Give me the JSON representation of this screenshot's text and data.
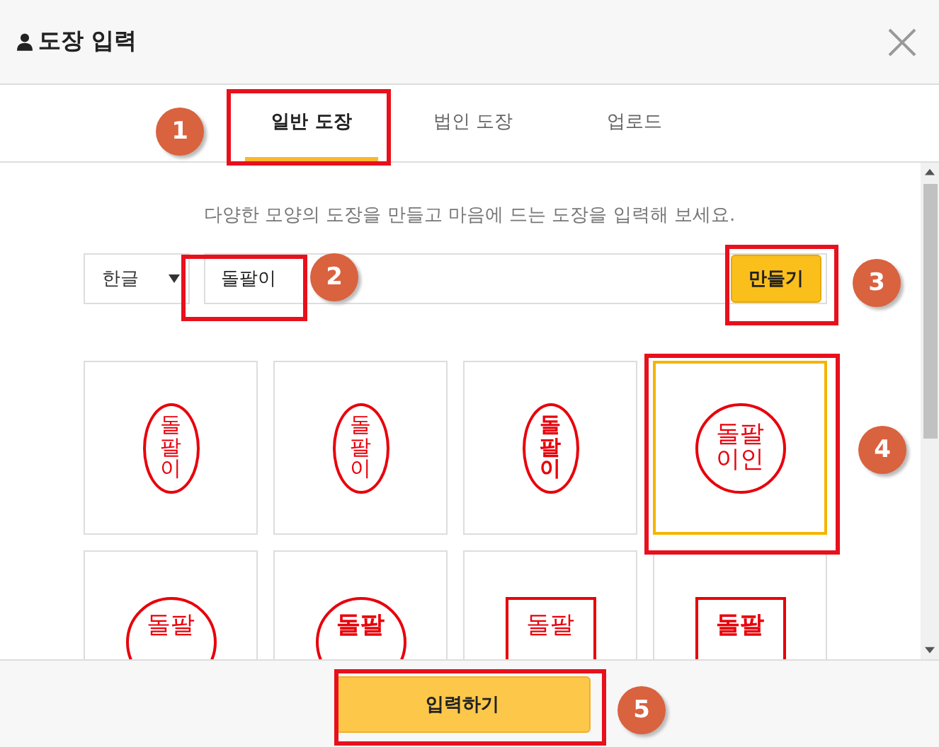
{
  "window": {
    "title": "도장 입력"
  },
  "tabs": [
    {
      "label": "일반 도장",
      "selected": true
    },
    {
      "label": "법인 도장",
      "selected": false
    },
    {
      "label": "업로드",
      "selected": false
    }
  ],
  "description": "다양한 모양의 도장을 만들고 마음에 드는 도장을 입력해 보세요.",
  "language_select": {
    "value": "한글"
  },
  "name_field": {
    "value": "돌팔이"
  },
  "make_button": "만들기",
  "stamps": [
    {
      "kind": "sealoval",
      "lines": [
        "돌",
        "팔",
        "이"
      ],
      "selected": false
    },
    {
      "kind": "oval",
      "lines": [
        "돌",
        "팔",
        "이"
      ],
      "selected": false
    },
    {
      "kind": "boldoval",
      "lines": [
        "돌",
        "팔",
        "이"
      ],
      "selected": false
    },
    {
      "kind": "sealcircle",
      "lines": [
        "돌팔",
        "이인"
      ],
      "selected": true
    },
    {
      "kind": "circle",
      "lines": [
        "돌팔"
      ],
      "selected": false
    },
    {
      "kind": "boldcircle",
      "lines": [
        "돌팔"
      ],
      "selected": false
    },
    {
      "kind": "sealsquare",
      "lines": [
        "돌팔"
      ],
      "selected": false
    },
    {
      "kind": "boldsquare",
      "lines": [
        "돌팔"
      ],
      "selected": false
    }
  ],
  "submit_button": "입력하기",
  "annotations": [
    {
      "number": "1"
    },
    {
      "number": "2"
    },
    {
      "number": "3"
    },
    {
      "number": "4"
    },
    {
      "number": "5"
    }
  ]
}
